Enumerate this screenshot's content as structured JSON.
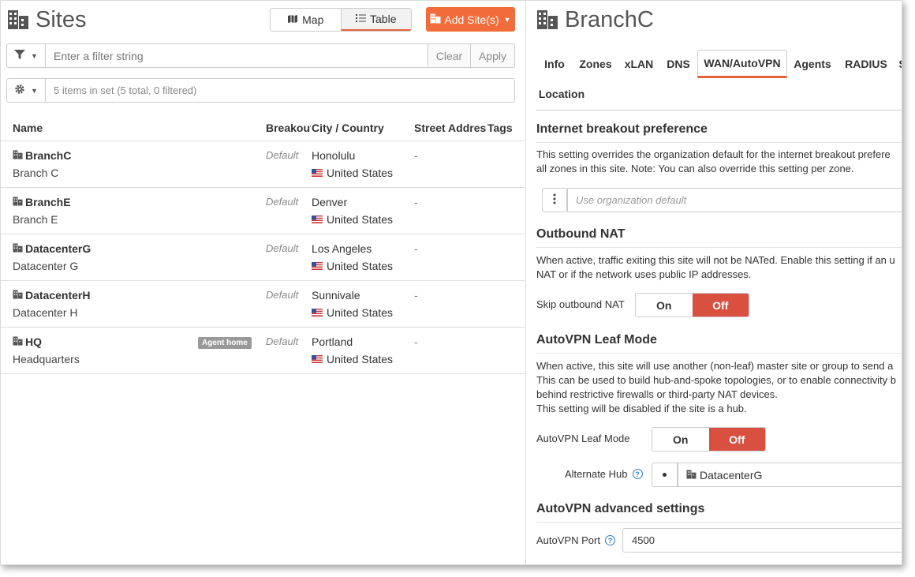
{
  "sites_panel": {
    "title": "Sites",
    "view_toggle": {
      "map_label": "Map",
      "table_label": "Table",
      "active": "Table"
    },
    "add_button_label": "Add Site(s)",
    "filter": {
      "placeholder": "Enter a filter string",
      "clear_label": "Clear",
      "apply_label": "Apply"
    },
    "set_info": "5 items in set (5 total, 0 filtered)",
    "columns": {
      "name": "Name",
      "breakout": "Breakout",
      "city_country": "City / Country",
      "street": "Street Address",
      "tags": "Tags"
    },
    "rows": [
      {
        "name": "BranchC",
        "desc": "Branch C",
        "badge": "",
        "breakout": "Default",
        "city": "Honolulu",
        "country": "United States",
        "street": "-"
      },
      {
        "name": "BranchE",
        "desc": "Branch E",
        "badge": "",
        "breakout": "Default",
        "city": "Denver",
        "country": "United States",
        "street": "-"
      },
      {
        "name": "DatacenterG",
        "desc": "Datacenter G",
        "badge": "",
        "breakout": "Default",
        "city": "Los Angeles",
        "country": "United States",
        "street": "-"
      },
      {
        "name": "DatacenterH",
        "desc": "Datacenter H",
        "badge": "",
        "breakout": "Default",
        "city": "Sunnivale",
        "country": "United States",
        "street": "-"
      },
      {
        "name": "HQ",
        "desc": "Headquarters",
        "badge": "Agent home",
        "breakout": "Default",
        "city": "Portland",
        "country": "United States",
        "street": "-"
      }
    ]
  },
  "detail_panel": {
    "title": "BranchC",
    "tabs": [
      {
        "label": "Info"
      },
      {
        "label": "Zones"
      },
      {
        "label": "xLAN"
      },
      {
        "label": "DNS"
      },
      {
        "label": "WAN/AutoVPN"
      },
      {
        "label": "Agents"
      },
      {
        "label": "RADIUS"
      },
      {
        "label": "S"
      },
      {
        "label": "Location"
      }
    ],
    "active_tab": "WAN/AutoVPN",
    "breakout": {
      "heading": "Internet breakout preference",
      "desc_lines": [
        "This setting overrides the organization default for the internet breakout prefere",
        "all zones in this site. Note: You can also override this setting per zone."
      ],
      "placeholder": "Use organization default"
    },
    "outbound_nat": {
      "heading": "Outbound NAT",
      "desc_lines": [
        "When active, traffic exiting this site will not be NATed. Enable this setting if an u",
        "NAT or if the network uses public IP addresses."
      ],
      "label": "Skip outbound NAT",
      "on_label": "On",
      "off_label": "Off",
      "value": "Off"
    },
    "leaf_mode": {
      "heading": "AutoVPN Leaf Mode",
      "desc_lines": [
        "When active, this site will use another (non-leaf) master site or group to send a",
        "This can be used to build hub-and-spoke topologies, or to enable connectivity b",
        "behind restrictive firewalls or third-party NAT devices.",
        "This setting will be disabled if the site is a hub."
      ],
      "label": "AutoVPN Leaf Mode",
      "on_label": "On",
      "off_label": "Off",
      "value": "Off",
      "alt_hub_label": "Alternate Hub",
      "alt_hub_value": "DatacenterG"
    },
    "advanced": {
      "heading": "AutoVPN advanced settings",
      "port_label": "AutoVPN Port",
      "port_value": "4500"
    }
  },
  "colors": {
    "accent": "#e8623a",
    "add_button": "#f26b3a",
    "off_active": "#d95040",
    "help": "#2d7fc1"
  }
}
